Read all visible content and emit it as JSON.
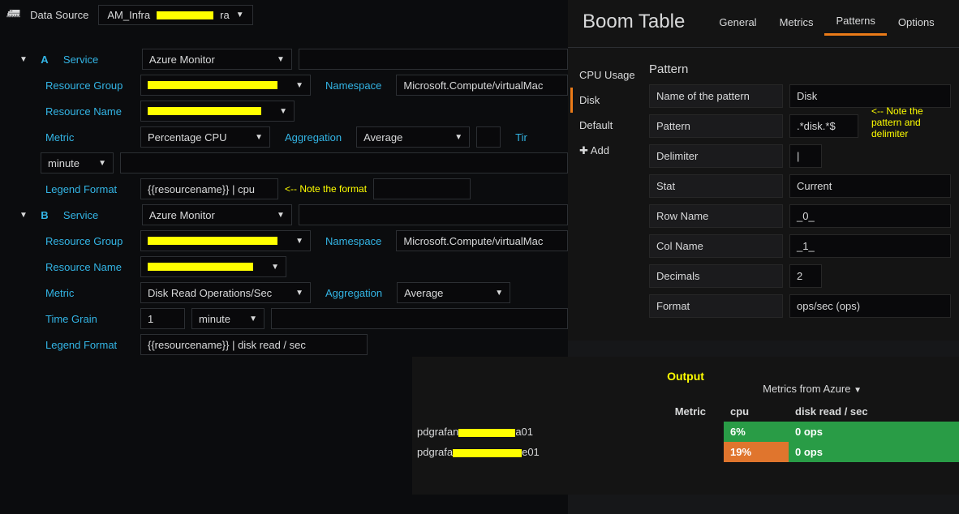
{
  "datasource": {
    "label": "Data Source",
    "selected_prefix": "AM_Infra",
    "selected_suffix": "ra"
  },
  "queries": {
    "A": {
      "letter": "A",
      "service_label": "Service",
      "service_value": "Azure Monitor",
      "rg_label": "Resource Group",
      "ns_label": "Namespace",
      "ns_value": "Microsoft.Compute/virtualMac",
      "rn_label": "Resource Name",
      "metric_label": "Metric",
      "metric_value": "Percentage CPU",
      "agg_label": "Aggregation",
      "agg_value": "Average",
      "tg_label_short": "Tir",
      "tg_units": "minute",
      "legend_label": "Legend Format",
      "legend_value": "{{resourcename}} | cpu",
      "legend_annot": "<-- Note the format"
    },
    "B": {
      "letter": "B",
      "service_label": "Service",
      "service_value": "Azure Monitor",
      "rg_label": "Resource Group",
      "ns_label": "Namespace",
      "ns_value": "Microsoft.Compute/virtualMac",
      "rn_label": "Resource Name",
      "metric_label": "Metric",
      "metric_value": "Disk Read Operations/Sec",
      "agg_label": "Aggregation",
      "agg_value": "Average",
      "tg_label": "Time Grain",
      "tg_value": "1",
      "tg_units": "minute",
      "legend_label": "Legend Format",
      "legend_value": "{{resourcename}} | disk read / sec"
    }
  },
  "boom": {
    "title": "Boom Table",
    "tabs": {
      "general": "General",
      "metrics": "Metrics",
      "patterns": "Patterns",
      "options": "Options"
    },
    "patterns_list": {
      "cpu": "CPU Usage",
      "disk": "Disk",
      "default": "Default",
      "add": "Add"
    },
    "form": {
      "heading": "Pattern",
      "name_label": "Name of the pattern",
      "name_value": "Disk",
      "pattern_label": "Pattern",
      "pattern_value": ".*disk.*$",
      "delim_label": "Delimiter",
      "delim_value": "|",
      "stat_label": "Stat",
      "stat_value": "Current",
      "row_label": "Row Name",
      "row_value": "_0_",
      "col_label": "Col Name",
      "col_value": "_1_",
      "dec_label": "Decimals",
      "dec_value": "2",
      "fmt_label": "Format",
      "fmt_value": "ops/sec (ops)"
    },
    "annot": "<-- Note the pattern and delimiter"
  },
  "output": {
    "title": "Output",
    "panel_title": "Metrics from Azure",
    "head_metric": "Metric",
    "head_cpu": "cpu",
    "head_disk": "disk read / sec",
    "rows": [
      {
        "metric_prefix": "pdgrafan",
        "metric_suffix": "a01",
        "cpu": "6%",
        "cpu_class": "green",
        "disk": "0 ops",
        "disk_class": "green"
      },
      {
        "metric_prefix": "pdgrafa",
        "metric_suffix": "e01",
        "cpu": "19%",
        "cpu_class": "orange",
        "disk": "0 ops",
        "disk_class": "green"
      }
    ]
  }
}
